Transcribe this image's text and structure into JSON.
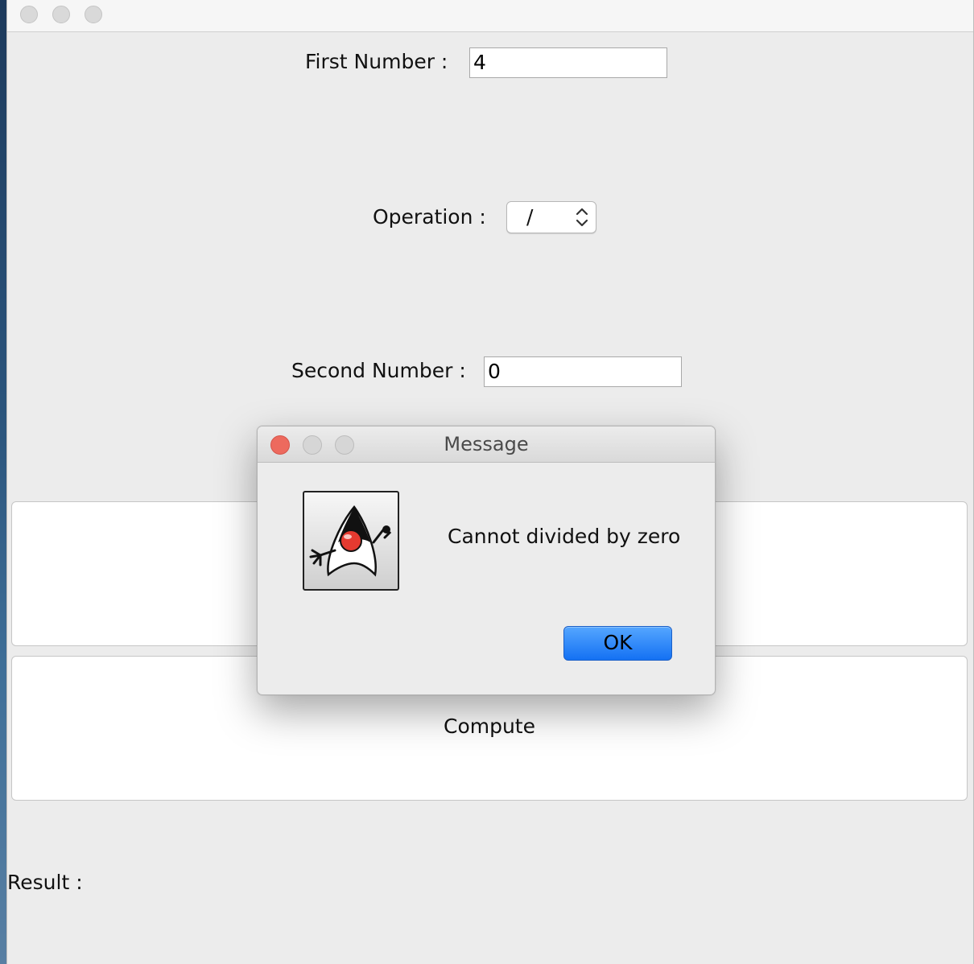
{
  "form": {
    "first_number_label": "First Number :",
    "first_number_value": "4",
    "operation_label": "Operation :",
    "operation_value": "/",
    "second_number_label": "Second Number :",
    "second_number_value": "0",
    "compute_label": "Compute",
    "result_label": "Result :"
  },
  "dialog": {
    "title": "Message",
    "message": "Cannot divided by zero",
    "ok_label": "OK",
    "icon": "java-duke-icon"
  },
  "colors": {
    "ok_button": "#1a73f5",
    "close_button": "#ed6a5e",
    "window_background": "#ececec"
  }
}
